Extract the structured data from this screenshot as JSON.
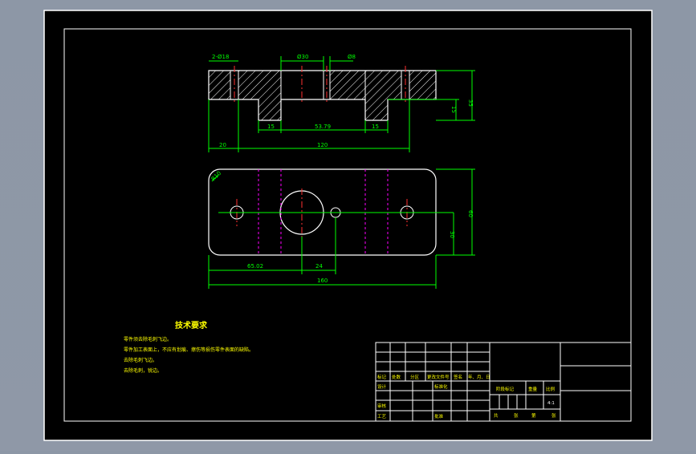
{
  "drawing": {
    "top_view_dims": {
      "holes_note": "2-Ø18",
      "bore_dia": "Ø30",
      "pin_dia": "Ø8",
      "height_total": "35",
      "height_lower": "15",
      "left_gap": "15",
      "slot_width": "53.79",
      "right_gap": "15",
      "left_offset": "20",
      "overall_length": "120"
    },
    "plan_view_dims": {
      "corner_radius": "R10",
      "width": "60",
      "half_width": "30",
      "bore_pos": "65.02",
      "pin_offset": "24",
      "overall": "160"
    }
  },
  "notes": {
    "title": "技术要求",
    "lines": [
      "零件须去除毛刺飞边。",
      "零件加工表面上，不应有划痕、擦伤等损伤零件表面的缺陷。",
      "去除毛刺飞边。",
      "去除毛刺，锐边。"
    ]
  },
  "title_block": {
    "labels": {
      "mark": "标记",
      "count": "处数",
      "zone": "分区",
      "change_doc": "更改文件号",
      "sign": "签名",
      "date": "年、月、日",
      "design": "设计",
      "standardize": "标准化",
      "stage_mark": "阶段标记",
      "weight": "重量",
      "scale": "比例",
      "scale_value": "4:1",
      "review": "审核",
      "process": "工艺",
      "approve": "批准",
      "total": "共",
      "sheets": "张",
      "page": "第",
      "sheet": "张"
    }
  },
  "colors": {
    "background": "#000000",
    "outline": "#ffffff",
    "dimension": "#00ff00",
    "center": "#ff3030",
    "hidden": "#ff00ff",
    "hatch": "#ffffff",
    "text_yellow": "#ffff00"
  }
}
